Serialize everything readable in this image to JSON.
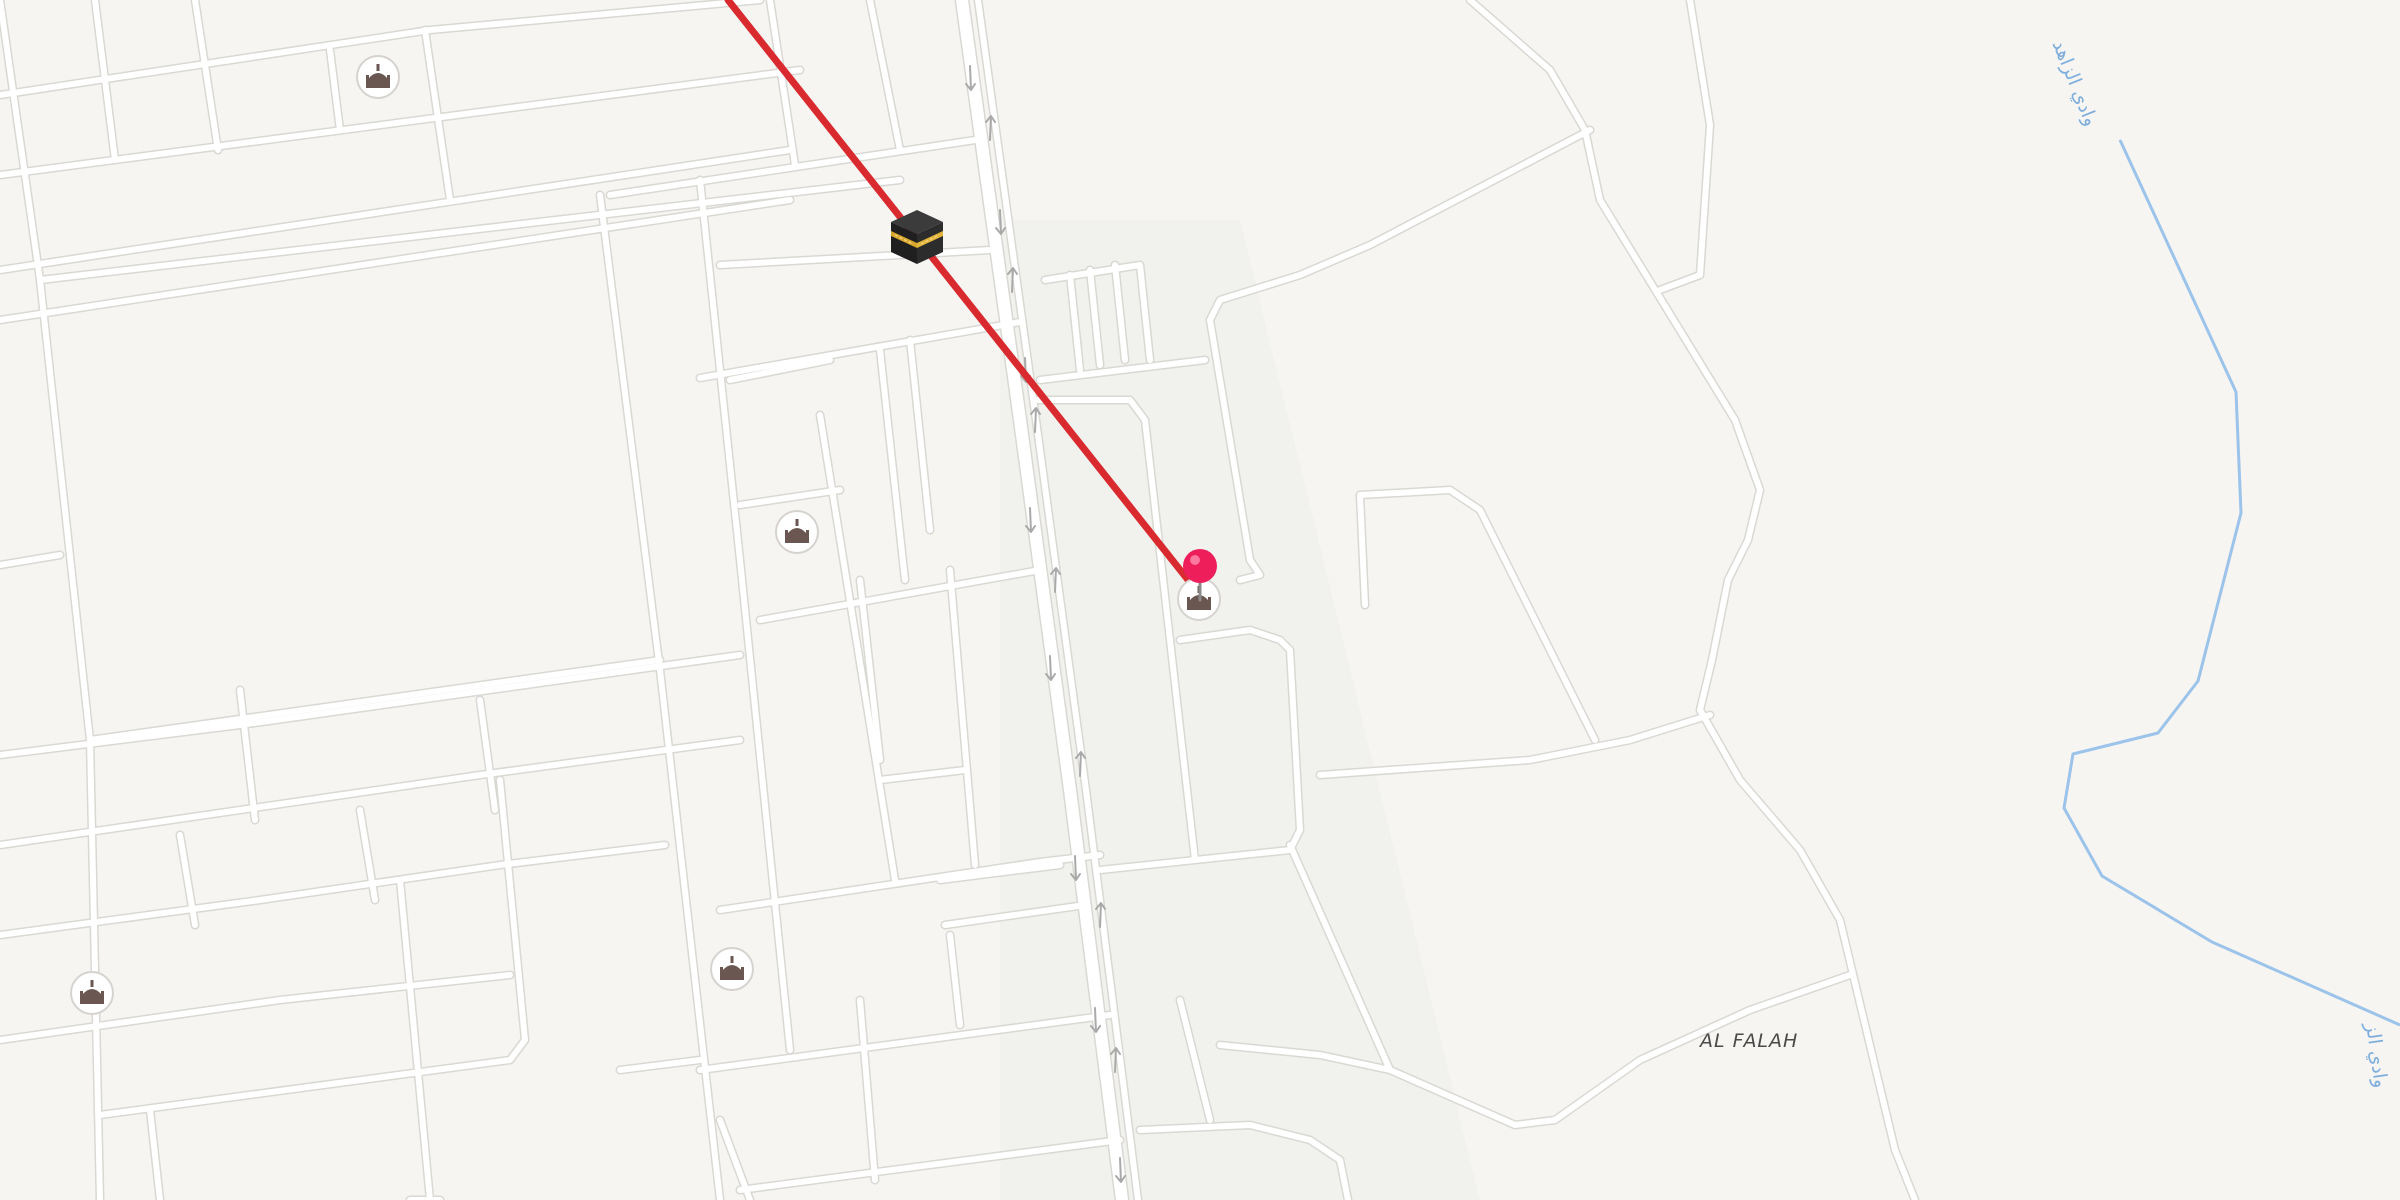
{
  "map": {
    "type": "street-map",
    "area_label": "AL FALAH",
    "wadi_labels": [
      "وادي الزاهد",
      "وادي الز"
    ],
    "colors": {
      "background": "#f6f5f2",
      "road": "#ffffff",
      "road_casing": "#dad8d3",
      "qibla_line": "#d92b2f",
      "wadi": "#9cc3ea",
      "pin": "#ee1e5b"
    },
    "markers": {
      "location_pin": "location-pin-icon",
      "kaaba": "kaaba-icon",
      "mosque": "mosque-icon"
    }
  }
}
